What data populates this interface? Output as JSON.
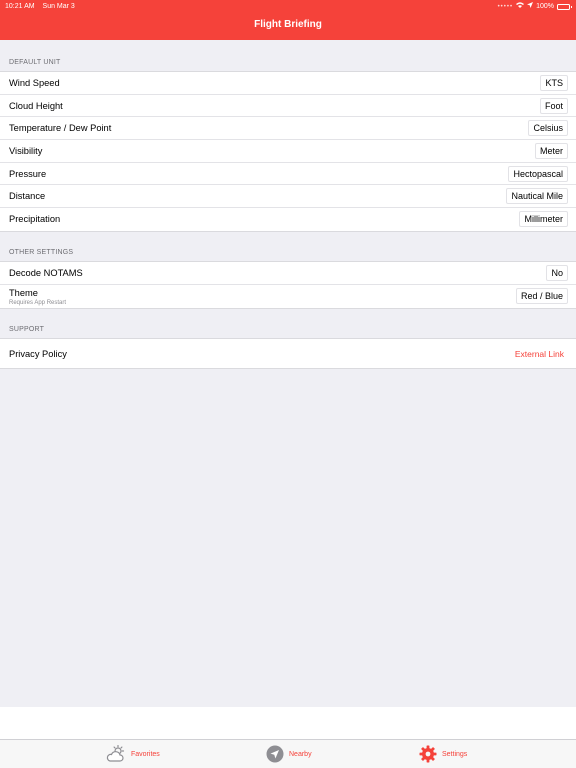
{
  "status_bar": {
    "time": "10:21 AM",
    "date": "Sun Mar 3",
    "signal": "•••••",
    "battery": "100%"
  },
  "nav": {
    "title": "Flight Briefing"
  },
  "sections": {
    "default_unit": {
      "header": "DEFAULT UNIT",
      "rows": [
        {
          "label": "Wind Speed",
          "value": "KTS"
        },
        {
          "label": "Cloud Height",
          "value": "Foot"
        },
        {
          "label": "Temperature / Dew Point",
          "value": "Celsius"
        },
        {
          "label": "Visibility",
          "value": "Meter"
        },
        {
          "label": "Pressure",
          "value": "Hectopascal"
        },
        {
          "label": "Distance",
          "value": "Nautical Mile"
        },
        {
          "label": "Precipitation",
          "value": "Millimeter"
        }
      ]
    },
    "other_settings": {
      "header": "OTHER SETTINGS",
      "rows": [
        {
          "label": "Decode NOTAMS",
          "value": "No"
        },
        {
          "label": "Theme",
          "sub": "Requires App Restart",
          "value": "Red / Blue"
        }
      ]
    },
    "support": {
      "header": "SUPPORT",
      "rows": [
        {
          "label": "Privacy Policy",
          "value": "External Link"
        }
      ]
    }
  },
  "tabs": [
    {
      "label": "Favorites",
      "icon": "cloud-sun-icon"
    },
    {
      "label": "Nearby",
      "icon": "location-arrow-icon"
    },
    {
      "label": "Settings",
      "icon": "gear-icon"
    }
  ],
  "colors": {
    "accent": "#f5423a",
    "background": "#efeff4",
    "inactive_icon": "#8e8e93"
  }
}
